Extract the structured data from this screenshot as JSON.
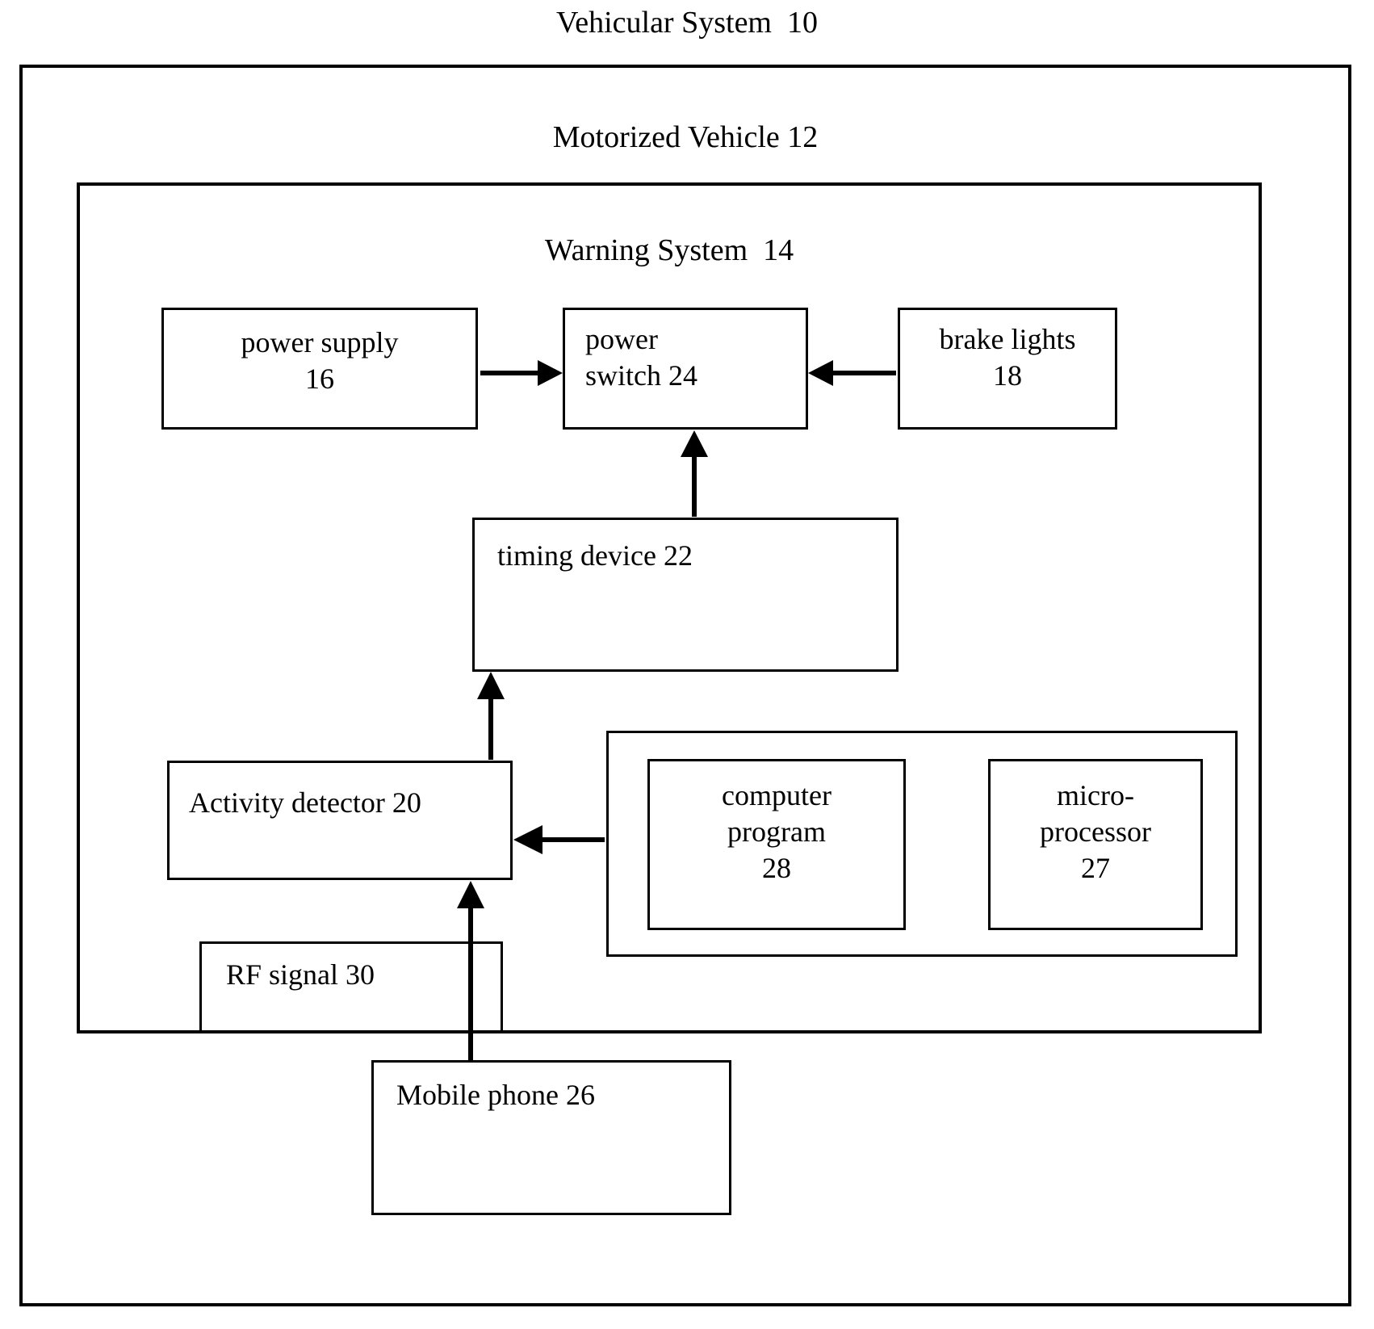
{
  "figure": {
    "title": "Vehicular System  10",
    "outer_label": "Motorized Vehicle 12",
    "inner_label": "Warning System  14"
  },
  "boxes": {
    "power_supply": {
      "label": "power supply\n16"
    },
    "power_switch": {
      "label": "power\nswitch  24"
    },
    "brake_lights": {
      "label": "brake lights\n18"
    },
    "timing_device": {
      "label": "timing device  22"
    },
    "activity_detector": {
      "label": "Activity detector  20"
    },
    "computer_program": {
      "label": "computer\nprogram\n28"
    },
    "microprocessor": {
      "label": "micro-\nprocessor\n27"
    },
    "rf_signal": {
      "label": "RF signal  30"
    },
    "mobile_phone": {
      "label": "Mobile phone    26"
    }
  },
  "connections": [
    {
      "name": "power-supply-to-power-switch",
      "from": "power_supply",
      "to": "power_switch",
      "direction": "right"
    },
    {
      "name": "brake-lights-to-power-switch",
      "from": "brake_lights",
      "to": "power_switch",
      "direction": "left"
    },
    {
      "name": "timing-device-to-power-switch",
      "from": "timing_device",
      "to": "power_switch",
      "direction": "up"
    },
    {
      "name": "activity-detector-to-timing-device",
      "from": "activity_detector",
      "to": "timing_device",
      "direction": "up"
    },
    {
      "name": "controller-to-activity-detector",
      "from": "controller_container",
      "to": "activity_detector",
      "direction": "left"
    },
    {
      "name": "mobile-phone-to-activity-detector",
      "from": "mobile_phone",
      "to": "activity_detector",
      "direction": "up"
    }
  ],
  "colors": {
    "line": "#000000",
    "background": "#ffffff"
  }
}
